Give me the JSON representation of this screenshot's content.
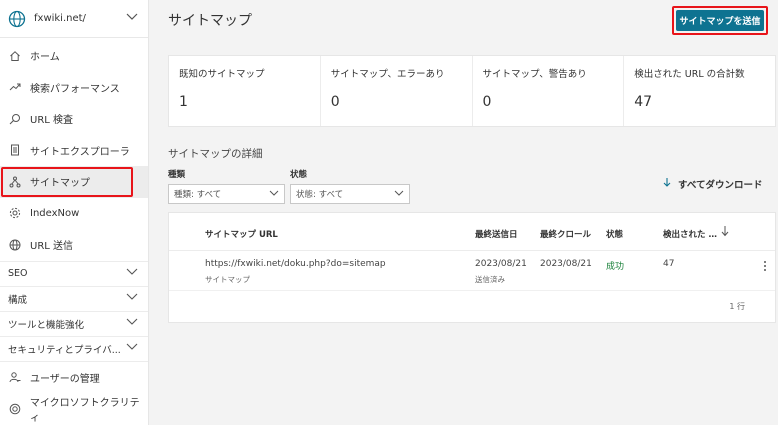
{
  "sidebar": {
    "site": "fxwiki.net/",
    "items": [
      {
        "label": "ホーム",
        "icon": "home-icon"
      },
      {
        "label": "検索パフォーマンス",
        "icon": "trending-icon"
      },
      {
        "label": "URL 検査",
        "icon": "search-icon"
      },
      {
        "label": "サイトエクスプローラ",
        "icon": "document-icon"
      },
      {
        "label": "サイトマップ",
        "icon": "sitemap-icon"
      },
      {
        "label": "IndexNow",
        "icon": "gear-icon"
      },
      {
        "label": "URL 送信",
        "icon": "globe-icon"
      }
    ],
    "sections": [
      "SEO",
      "構成",
      "ツールと機能強化",
      "セキュリティとプライバ..."
    ],
    "bottom_items": [
      {
        "label": "ユーザーの管理",
        "icon": "user-icon"
      },
      {
        "label": "マイクロソフトクラリティ",
        "icon": "clarity-icon"
      }
    ]
  },
  "header": {
    "title": "サイトマップ",
    "submit_label": "サイトマップを送信",
    "accent_color": "#0e7391"
  },
  "stats": [
    {
      "label": "既知のサイトマップ",
      "value": "1"
    },
    {
      "label": "サイトマップ、エラーあり",
      "value": "0"
    },
    {
      "label": "サイトマップ、警告あり",
      "value": "0"
    },
    {
      "label": "検出された URL の合計数",
      "value": "47"
    }
  ],
  "details": {
    "title": "サイトマップの詳細",
    "filters": {
      "type_label": "種類",
      "type_value": "種類: すべて",
      "status_label": "状態",
      "status_value": "状態: すべて"
    },
    "download_label": "すべてダウンロード"
  },
  "table": {
    "headers": [
      "サイトマップ URL",
      "最終送信日",
      "最終クロール",
      "状態",
      "検出された …"
    ],
    "rows": [
      {
        "url": "https://fxwiki.net/doku.php?do=sitemap",
        "url_sub": "サイトマップ",
        "last_submitted": "2023/08/21",
        "last_submitted_sub": "送信済み",
        "last_crawl": "2023/08/21",
        "status": "成功",
        "discovered": "47"
      }
    ],
    "footer": "1 行"
  }
}
